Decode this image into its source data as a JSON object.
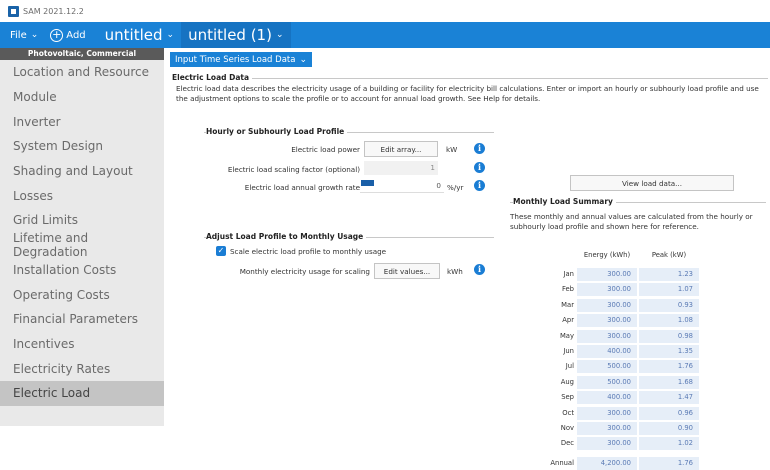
{
  "window": {
    "title": "SAM 2021.12.2"
  },
  "topbar": {
    "file_label": "File",
    "add_label": "Add",
    "cases": [
      {
        "label": "untitled"
      },
      {
        "label": "untitled (1)"
      }
    ]
  },
  "sidebar": {
    "header": "Photovoltaic, Commercial",
    "items": [
      {
        "label": "Location and Resource"
      },
      {
        "label": "Module"
      },
      {
        "label": "Inverter"
      },
      {
        "label": "System Design"
      },
      {
        "label": "Shading and Layout"
      },
      {
        "label": "Losses"
      },
      {
        "label": "Grid Limits"
      },
      {
        "label": "Lifetime and Degradation"
      },
      {
        "label": "Installation Costs"
      },
      {
        "label": "Operating Costs"
      },
      {
        "label": "Financial Parameters"
      },
      {
        "label": "Incentives"
      },
      {
        "label": "Electricity Rates"
      },
      {
        "label": "Electric Load"
      }
    ]
  },
  "page": {
    "tab_label": "Input Time Series Load Data",
    "section_title": "Electric Load Data",
    "description": "Electric load data describes the electricity usage of a building or facility for electricity bill calculations. Enter or import an hourly or subhourly load profile and use the adjustment options to scale the profile or to account for annual load growth. See Help for details."
  },
  "load_profile": {
    "title": "Hourly or Subhourly Load Profile",
    "power_label": "Electric load power",
    "power_button": "Edit array...",
    "power_unit": "kW",
    "scaling_label": "Electric load scaling factor (optional)",
    "scaling_value": "1",
    "growth_label": "Electric load annual growth rate",
    "growth_value": "0",
    "growth_unit": "%/yr"
  },
  "adjust": {
    "title": "Adjust Load Profile to Monthly Usage",
    "checkbox_label": "Scale electric load profile to monthly usage",
    "monthly_label": "Monthly electricity usage for scaling",
    "monthly_button": "Edit values...",
    "monthly_unit": "kWh"
  },
  "summary": {
    "view_button": "View load data...",
    "title": "Monthly Load Summary",
    "description": "These monthly and annual values are calculated from the hourly or subhourly load profile and shown here for reference.",
    "columns": [
      "Energy (kWh)",
      "Peak (kW)"
    ],
    "rows": [
      {
        "month": "Jan",
        "energy": "300.00",
        "peak": "1.23"
      },
      {
        "month": "Feb",
        "energy": "300.00",
        "peak": "1.07"
      },
      {
        "month": "Mar",
        "energy": "300.00",
        "peak": "0.93"
      },
      {
        "month": "Apr",
        "energy": "300.00",
        "peak": "1.08"
      },
      {
        "month": "May",
        "energy": "300.00",
        "peak": "0.98"
      },
      {
        "month": "Jun",
        "energy": "400.00",
        "peak": "1.35"
      },
      {
        "month": "Jul",
        "energy": "500.00",
        "peak": "1.76"
      },
      {
        "month": "Aug",
        "energy": "500.00",
        "peak": "1.68"
      },
      {
        "month": "Sep",
        "energy": "400.00",
        "peak": "1.47"
      },
      {
        "month": "Oct",
        "energy": "300.00",
        "peak": "0.96"
      },
      {
        "month": "Nov",
        "energy": "300.00",
        "peak": "0.90"
      },
      {
        "month": "Dec",
        "energy": "300.00",
        "peak": "1.02"
      }
    ],
    "annual": {
      "label": "Annual",
      "energy": "4,200.00",
      "peak": "1.76"
    }
  },
  "colors": {
    "accent": "#1a82d6",
    "sidebar_bg": "#e9e9e9",
    "cell_bg": "#e6eef8"
  }
}
